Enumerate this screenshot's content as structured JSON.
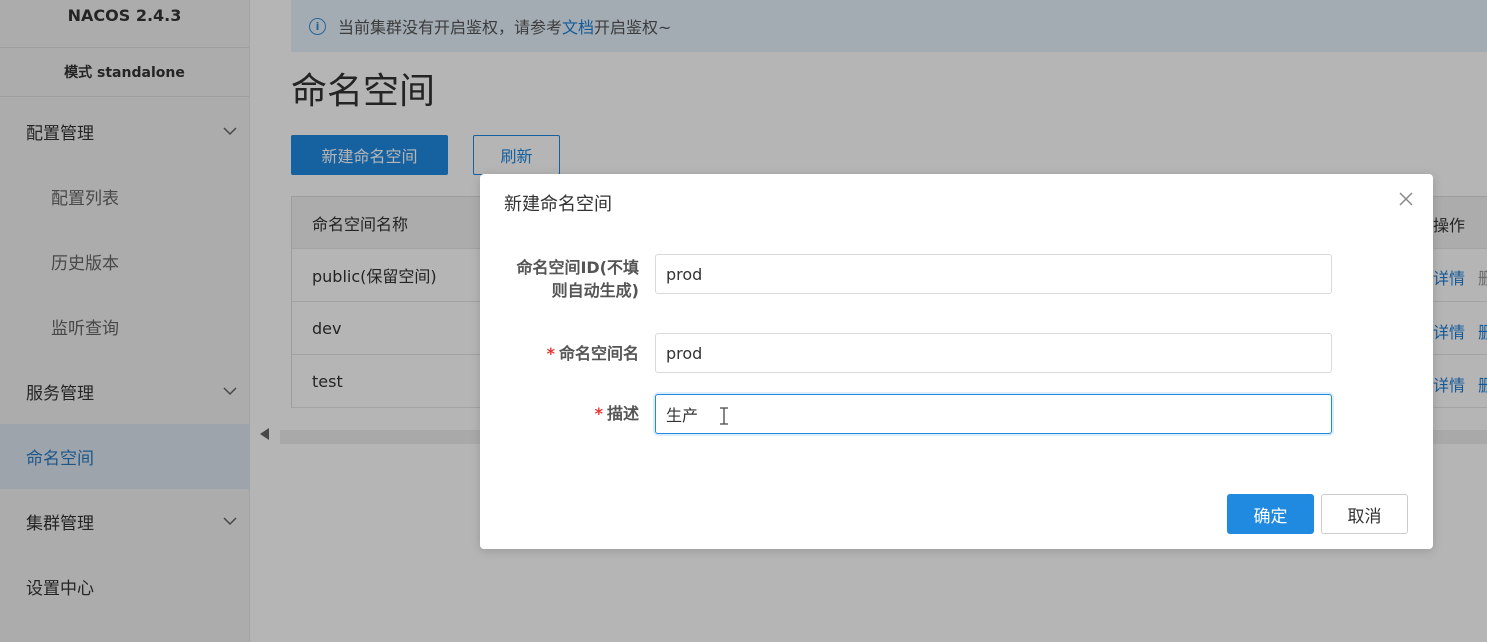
{
  "sidebar": {
    "brand": "NACOS 2.4.3",
    "mode": "模式 standalone",
    "items": [
      {
        "label": "配置管理"
      },
      {
        "label": "配置列表"
      },
      {
        "label": "历史版本"
      },
      {
        "label": "监听查询"
      },
      {
        "label": "服务管理"
      },
      {
        "label": "命名空间"
      },
      {
        "label": "集群管理"
      },
      {
        "label": "设置中心"
      }
    ]
  },
  "notice": {
    "prefix": "当前集群没有开启鉴权，请参考",
    "link": "文档",
    "suffix": "开启鉴权~"
  },
  "page": {
    "title": "命名空间",
    "new_button": "新建命名空间",
    "refresh_button": "刷新"
  },
  "table": {
    "header": "命名空间名称",
    "ops_header": "操作",
    "rows": [
      {
        "name": "public(保留空间)",
        "op1": "详情",
        "op2": "删"
      },
      {
        "name": "dev",
        "op1": "详情",
        "op2": "删"
      },
      {
        "name": "test",
        "op1": "详情",
        "op2": "删"
      }
    ]
  },
  "dialog": {
    "title": "新建命名空间",
    "fields": {
      "id_label_line1": "命名空间ID(不填",
      "id_label_line2": "则自动生成)",
      "id_value": "prod",
      "name_label": "命名空间名",
      "name_value": "prod",
      "desc_label": "描述",
      "desc_value": "生产"
    },
    "required_mark": "*",
    "confirm": "确定",
    "cancel": "取消"
  }
}
